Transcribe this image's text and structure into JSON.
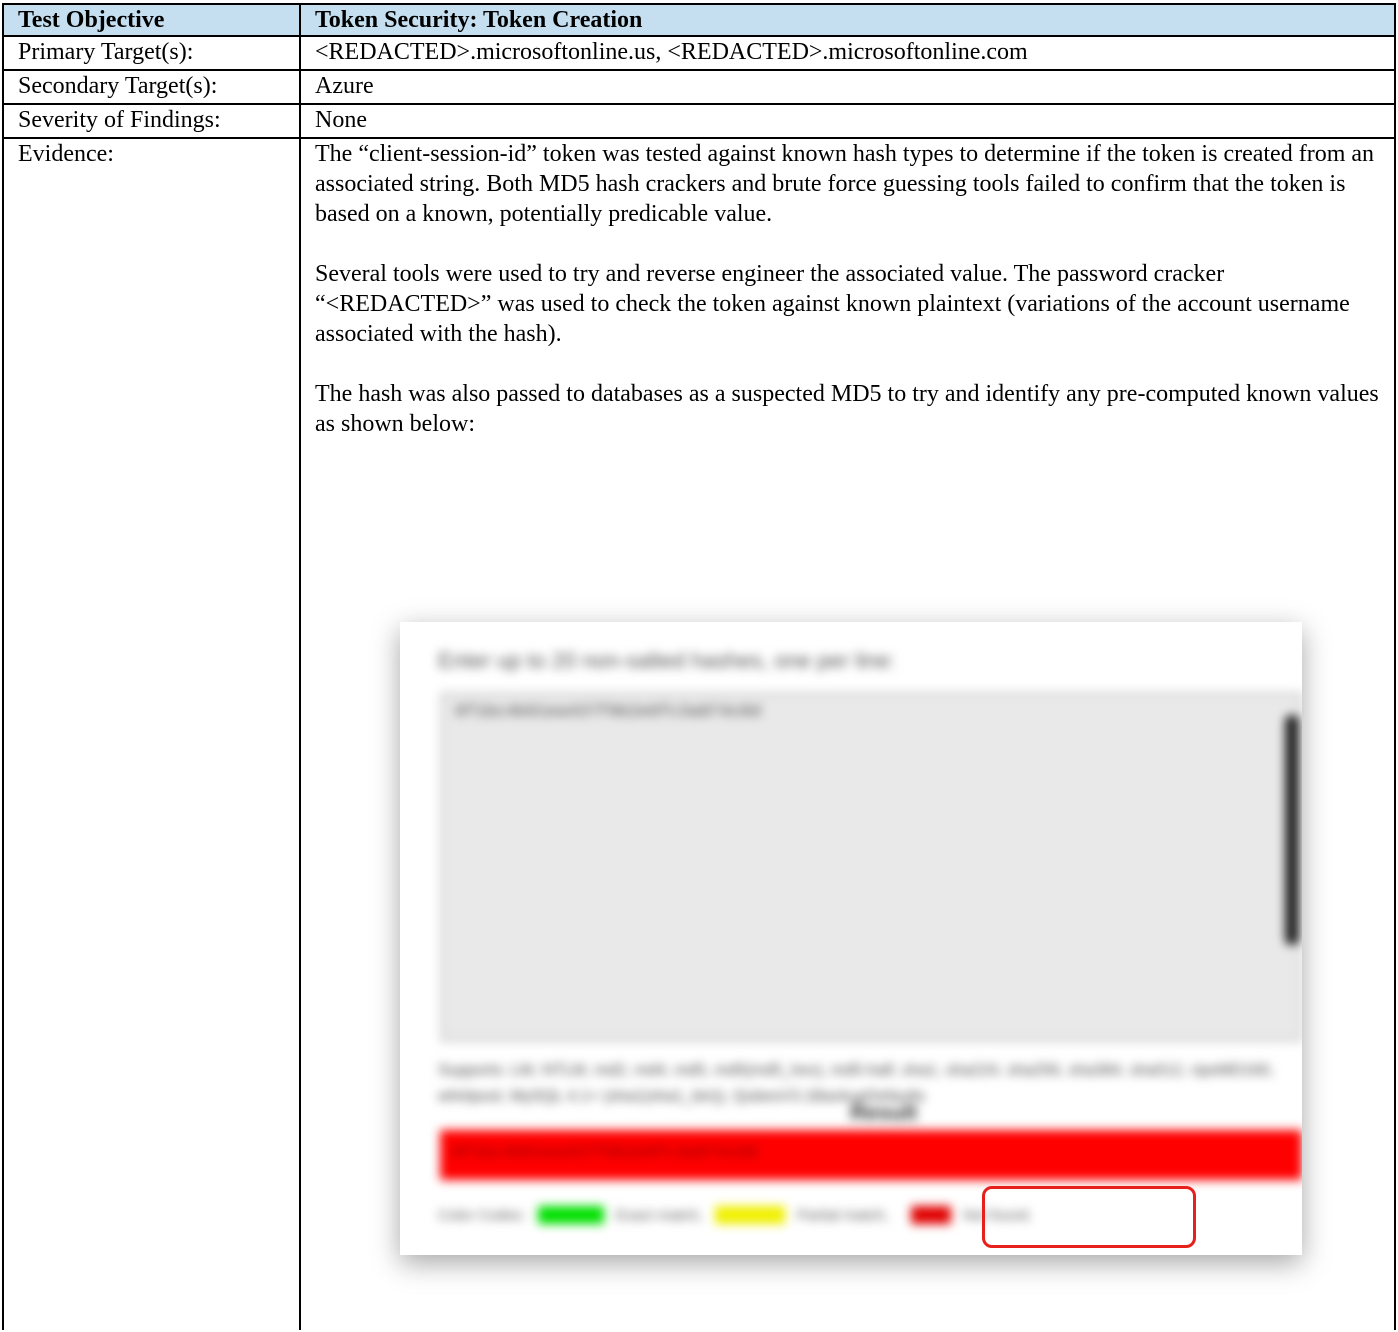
{
  "header": {
    "col1": "Test Objective",
    "col2": "Token Security: Token Creation"
  },
  "rows": [
    {
      "label": "Primary Target(s):",
      "value": "<REDACTED>.microsoftonline.us, <REDACTED>.microsoftonline.com"
    },
    {
      "label": "Secondary Target(s):",
      "value": "Azure"
    },
    {
      "label": "Severity of Findings:",
      "value": "None"
    }
  ],
  "evidence": {
    "label": "Evidence:",
    "paragraphs": [
      "The “client-session-id” token was tested against known hash types to determine if the token is created from an associated string.  Both MD5 hash crackers and brute force guessing tools failed to confirm that the token is based on a known, potentially predicable value.",
      "Several tools were used to try and reverse engineer the associated value.  The password cracker “<REDACTED>” was used to check the token against known plaintext (variations of the account username associated with the hash).",
      "The hash was also passed to databases as a suspected MD5 to try and identify any pre-computed known values as shown below:"
    ]
  },
  "figure": {
    "prompt": "Enter up to 20 non-salted hashes, one per line:",
    "hash": "8f1bc4b91ea437f9b2e6fc3a074c0d",
    "supports": "Supports: LM, NTLM, md2, md4, md5, md5(md5_hex), md5-half, sha1, sha224, sha256, sha384, sha512, ripeMD160, whirlpool, MySQL 4.1+ (sha1(sha1_bin)), QubesV3.1BackupDefaults",
    "result_heading": "Result",
    "result_hash": "8f1bc4b91ea437f9b2e6fc3a074c0d",
    "legend_label": "Color Codes:",
    "legend_exact": "Exact match,",
    "legend_partial": "Partial match,",
    "legend_notfound": "Not found.",
    "colors": {
      "exact": "#00e000",
      "partial": "#f0f000",
      "notfound": "#ff0000",
      "highlight": "#e8201c"
    }
  }
}
